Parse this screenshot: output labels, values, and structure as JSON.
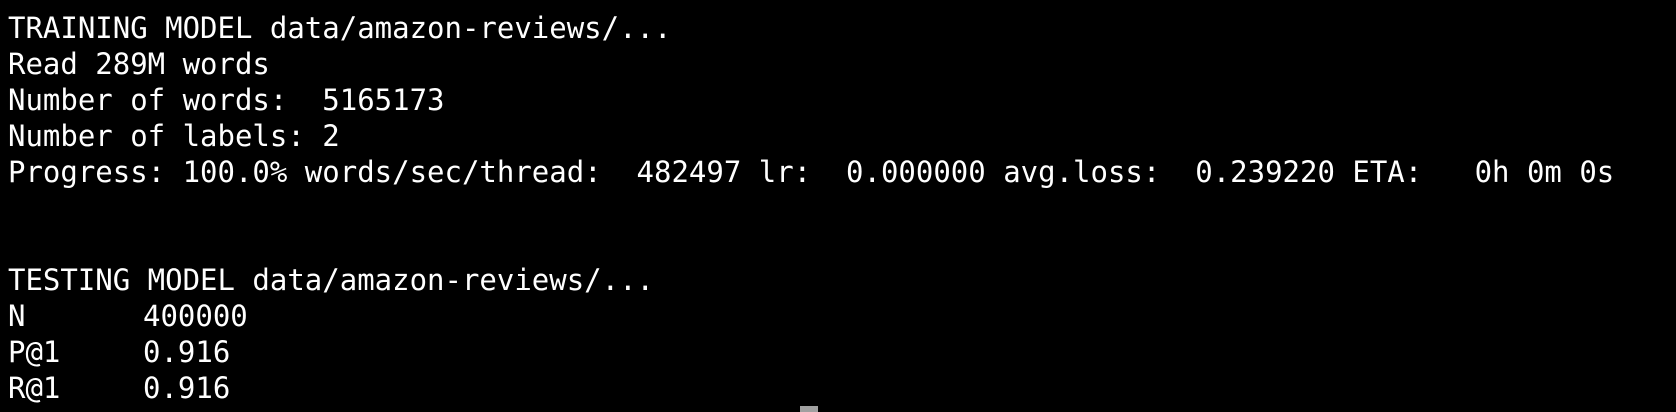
{
  "colors": {
    "background": "#000000",
    "text": "#ffffff",
    "cursor": "#a0a0a0"
  },
  "terminal": {
    "train_header": "TRAINING MODEL data/amazon-reviews/...",
    "read_words": "Read 289M words",
    "num_words": "Number of words:  5165173",
    "num_labels": "Number of labels: 2",
    "progress": "Progress: 100.0% words/sec/thread:  482497 lr:  0.000000 avg.loss:  0.239220 ETA:   0h 0m 0s",
    "test_header": "TESTING MODEL data/amazon-reviews/...",
    "results": [
      {
        "label": "N",
        "value": "400000"
      },
      {
        "label": "P@1",
        "value": "0.916"
      },
      {
        "label": "R@1",
        "value": "0.916"
      }
    ]
  }
}
